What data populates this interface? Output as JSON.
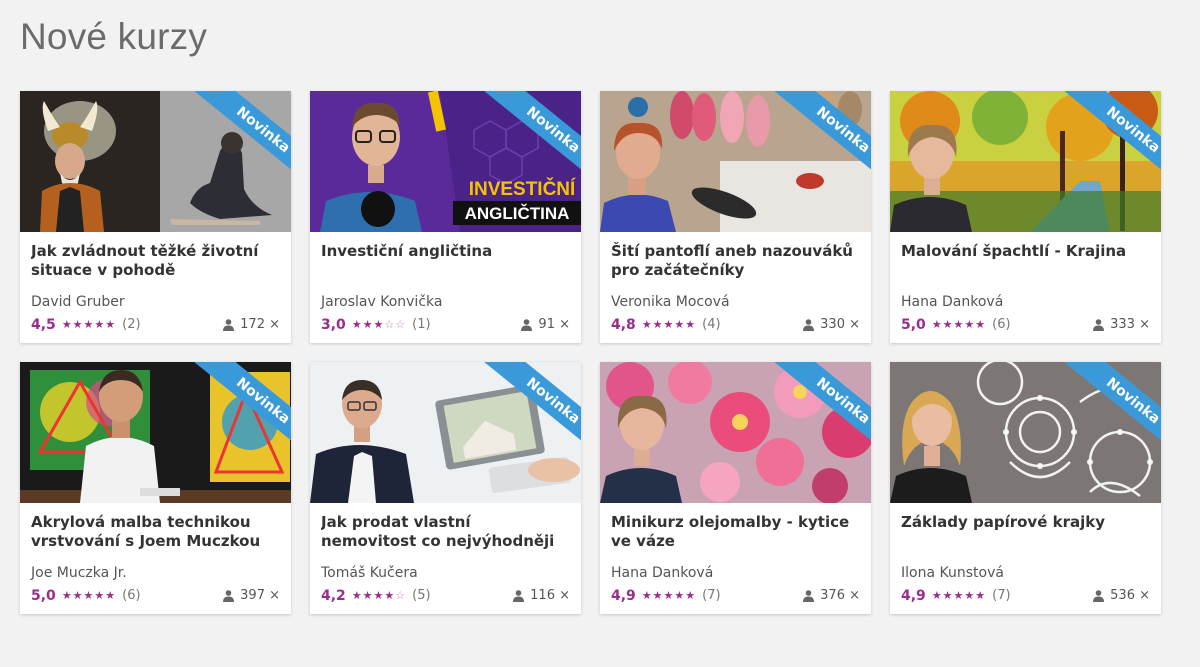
{
  "section": {
    "title": "Nové kurzy"
  },
  "colors": {
    "accent": "#9b2c8f",
    "ribbon": "#3a9ad9"
  },
  "courses": [
    {
      "title": "Jak zvládnout těžké životní situace v pohodě",
      "badge": "Novinka",
      "author": "David Gruber",
      "rating": "4,5",
      "stars": 5,
      "reviews": "(2)",
      "students": "172 ×"
    },
    {
      "title": "Investiční angličtina",
      "badge": "Novinka",
      "author": "Jaroslav Konvička",
      "rating": "3,0",
      "stars": 3,
      "reviews": "(1)",
      "students": "91 ×",
      "thumb_text_1": "INVESTIČNÍ",
      "thumb_text_2": "ANGLIČTINA"
    },
    {
      "title": "Šití pantoflí aneb nazouváků pro začátečníky",
      "badge": "Novinka",
      "author": "Veronika Mocová",
      "rating": "4,8",
      "stars": 5,
      "reviews": "(4)",
      "students": "330 ×"
    },
    {
      "title": "Malování špachtlí - Krajina",
      "badge": "Novinka",
      "author": "Hana Danková",
      "rating": "5,0",
      "stars": 5,
      "reviews": "(6)",
      "students": "333 ×"
    },
    {
      "title": "Akrylová malba technikou vrstvování s Joem Muczkou",
      "badge": "Novinka",
      "author": "Joe Muczka Jr.",
      "rating": "5,0",
      "stars": 5,
      "reviews": "(6)",
      "students": "397 ×"
    },
    {
      "title": "Jak prodat vlastní nemovitost co nejvýhodněji",
      "badge": "Novinka",
      "author": "Tomáš Kučera",
      "rating": "4,2",
      "stars": 4,
      "reviews": "(5)",
      "students": "116 ×"
    },
    {
      "title": "Minikurz olejomalby - kytice ve váze",
      "badge": "Novinka",
      "author": "Hana Danková",
      "rating": "4,9",
      "stars": 5,
      "reviews": "(7)",
      "students": "376 ×"
    },
    {
      "title": "Základy papírové krajky",
      "badge": "Novinka",
      "author": "Ilona Kunstová",
      "rating": "4,9",
      "stars": 5,
      "reviews": "(7)",
      "students": "536 ×"
    }
  ]
}
